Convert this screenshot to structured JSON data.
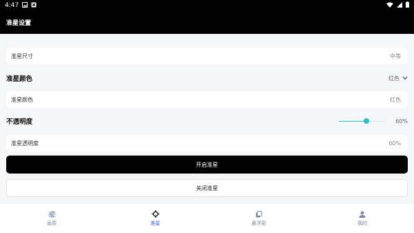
{
  "status_bar": {
    "time": "4:47"
  },
  "app_bar": {
    "title": "准星设置"
  },
  "crosshair_size": {
    "label": "准星尺寸",
    "value": "中等"
  },
  "color_section": {
    "title": "准星颜色",
    "selected": "红色"
  },
  "color_row": {
    "label": "准星颜色",
    "value": "红色"
  },
  "opacity_section": {
    "title": "不透明度",
    "value_text": "60%",
    "value": 0.6
  },
  "opacity_row": {
    "label": "准星透明度",
    "value": "60%"
  },
  "buttons": {
    "enable": "开启准星",
    "disable": "关闭准星"
  },
  "bottom_nav": [
    {
      "label": "画质",
      "icon": "sliders-icon",
      "active": false
    },
    {
      "label": "准星",
      "icon": "crosshair-icon",
      "active": true
    },
    {
      "label": "悬浮窗",
      "icon": "floating-window-icon",
      "active": false
    },
    {
      "label": "我的",
      "icon": "user-icon",
      "active": false
    }
  ],
  "colors": {
    "accent": "#22c6c6",
    "nav_active": "#3b5bdb",
    "nav_inactive": "#7a8aa8",
    "primary_button": "#000000"
  }
}
